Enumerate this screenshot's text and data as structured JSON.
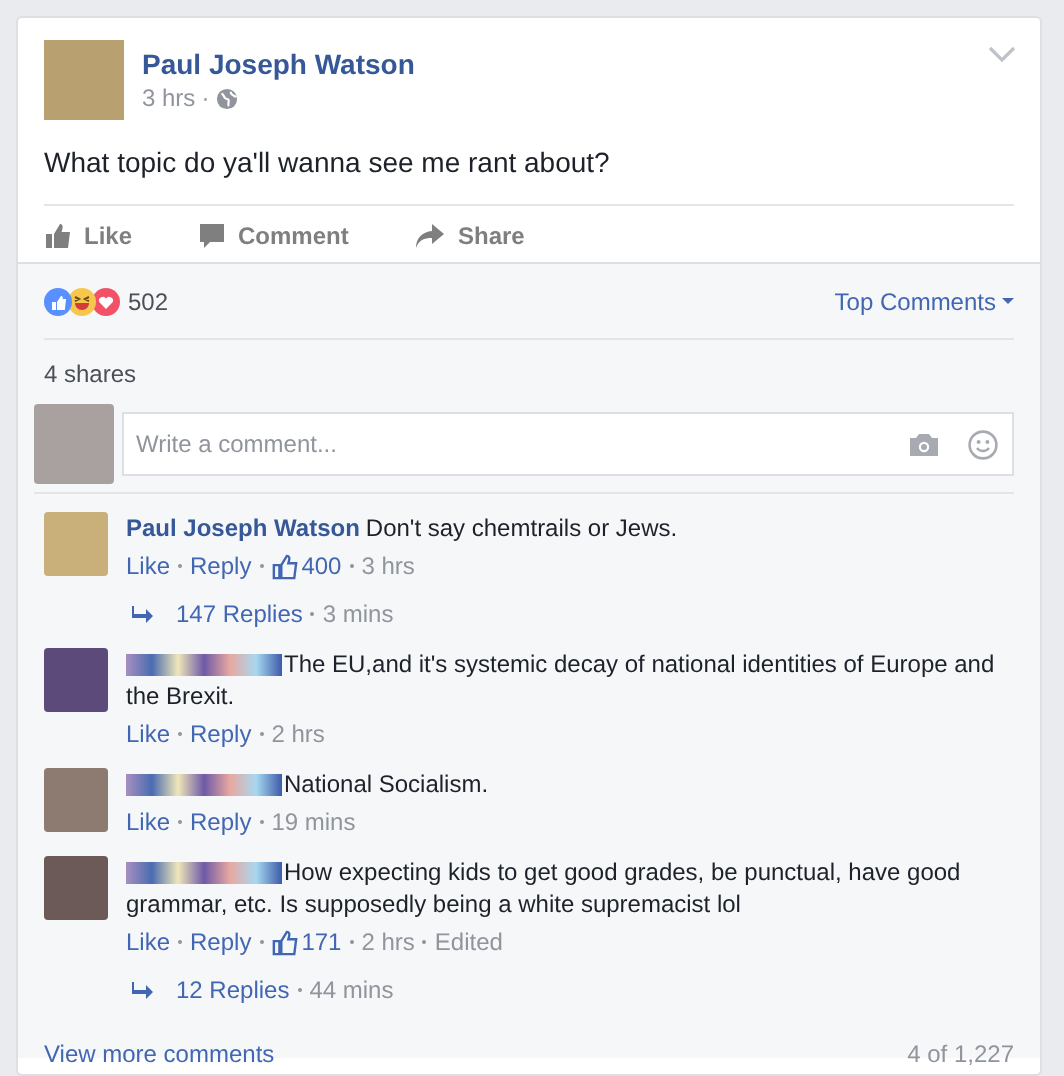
{
  "post": {
    "author": "Paul Joseph Watson",
    "time": "3 hrs",
    "separator": "·",
    "text": "What topic do ya'll wanna see me rant about?"
  },
  "actions": [
    "Like",
    "Comment",
    "Share"
  ],
  "reactions": {
    "count": "502",
    "sort": "Top Comments"
  },
  "shares": "4 shares",
  "comment_box": {
    "placeholder": "Write a comment..."
  },
  "comments": [
    {
      "kind": "named",
      "author": "Paul Joseph Watson",
      "text": "Don't say chemtrails or Jews.",
      "like": "Like",
      "reply": "Reply",
      "likes": "400",
      "time": "3 hrs",
      "replies": {
        "count": "147 Replies",
        "time": "3 mins"
      }
    },
    {
      "kind": "redacted",
      "text": "The EU,and it's systemic decay of national identities of Europe and the Brexit.",
      "like": "Like",
      "reply": "Reply",
      "time": "2 hrs"
    },
    {
      "kind": "redacted",
      "text": "National Socialism.",
      "like": "Like",
      "reply": "Reply",
      "time": "19 mins"
    },
    {
      "kind": "redacted",
      "text": "How expecting kids to get good grades, be punctual, have good grammar, etc. Is supposedly being a white supremacist lol",
      "like": "Like",
      "reply": "Reply",
      "likes": "171",
      "time": "2 hrs",
      "edited": "Edited",
      "replies": {
        "count": "12 Replies",
        "time": "44 mins"
      }
    }
  ],
  "footer": {
    "more": "View more comments",
    "count": "4 of 1,227"
  }
}
